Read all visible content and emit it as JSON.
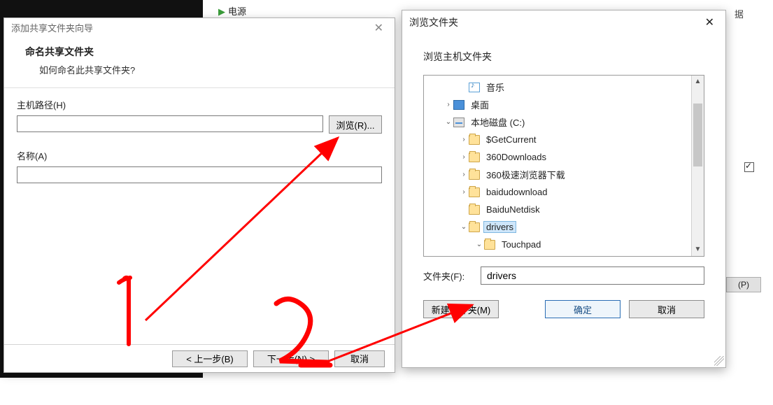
{
  "background": {
    "power_label": "电源",
    "right_snippet": "据",
    "p_button": "(P)"
  },
  "wizard": {
    "window_title": "添加共享文件夹向导",
    "heading": "命名共享文件夹",
    "subheading": "如何命名此共享文件夹?",
    "host_path_label": "主机路径(H)",
    "host_path_value": "",
    "browse_button": "浏览(R)...",
    "name_label": "名称(A)",
    "name_value": "",
    "back_button": "< 上一步(B)",
    "next_button": "下一步(N) >",
    "cancel_button": "取消"
  },
  "browse": {
    "window_title": "浏览文件夹",
    "subtitle": "浏览主机文件夹",
    "folder_field_label": "文件夹(F):",
    "folder_field_value": "drivers",
    "new_folder_button": "新建文件夹(M)",
    "ok_button": "确定",
    "cancel_button": "取消",
    "tree": [
      {
        "depth": 2,
        "expander": "",
        "icon": "music",
        "label": "音乐"
      },
      {
        "depth": 1,
        "expander": ">",
        "icon": "desktop",
        "label": "桌面"
      },
      {
        "depth": 1,
        "expander": "v",
        "icon": "disk",
        "label": "本地磁盘 (C:)"
      },
      {
        "depth": 2,
        "expander": ">",
        "icon": "folder",
        "label": "$GetCurrent"
      },
      {
        "depth": 2,
        "expander": ">",
        "icon": "folder",
        "label": "360Downloads"
      },
      {
        "depth": 2,
        "expander": ">",
        "icon": "folder",
        "label": "360极速浏览器下载"
      },
      {
        "depth": 2,
        "expander": ">",
        "icon": "folder",
        "label": "baidudownload"
      },
      {
        "depth": 2,
        "expander": "",
        "icon": "folder",
        "label": "BaiduNetdisk"
      },
      {
        "depth": 2,
        "expander": "v",
        "icon": "folder",
        "label": "drivers",
        "selected": true
      },
      {
        "depth": 3,
        "expander": "v",
        "icon": "folder",
        "label": "Touchpad"
      }
    ]
  },
  "annotations": {
    "mark1": "1",
    "mark2": "2",
    "color": "#ff0000"
  }
}
